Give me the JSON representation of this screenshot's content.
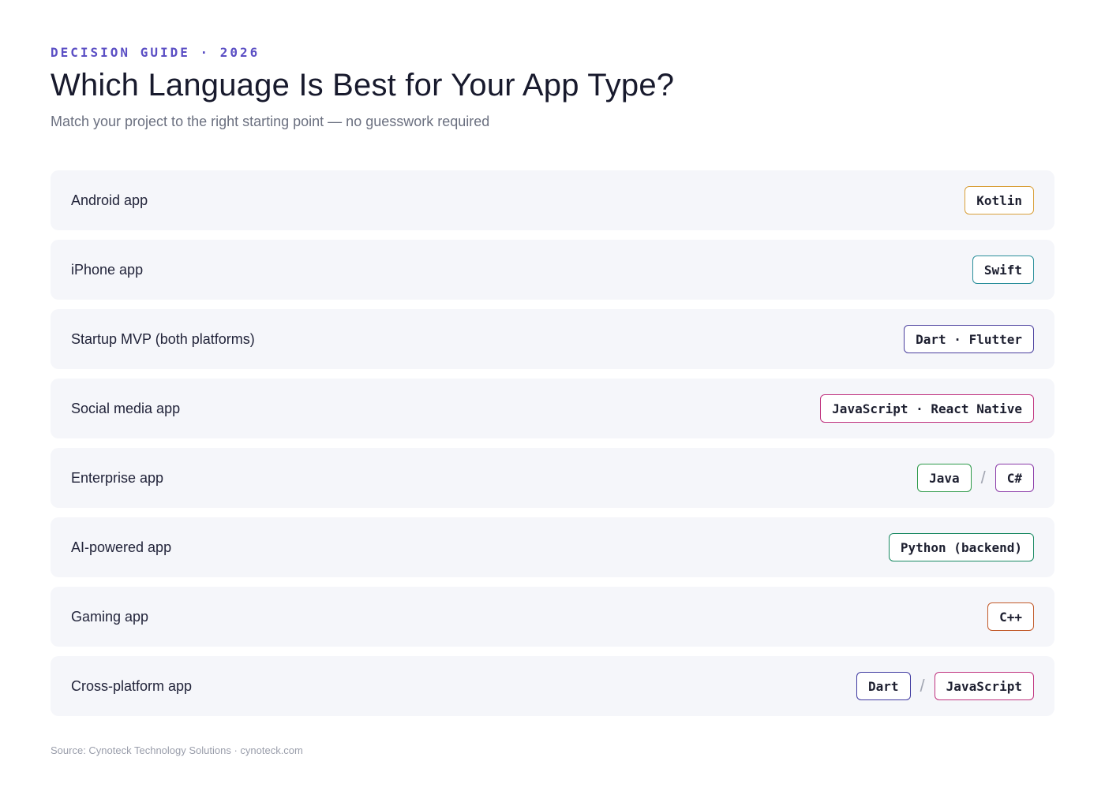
{
  "header": {
    "eyebrow": "DECISION GUIDE · 2026",
    "title": "Which Language Is Best for Your App Type?",
    "subtitle": "Match your project to the right starting point — no guesswork required"
  },
  "separator": "/",
  "rows": [
    {
      "label": "Android app",
      "tags": [
        {
          "text": "Kotlin",
          "color": "#d9a03a"
        }
      ]
    },
    {
      "label": "iPhone app",
      "tags": [
        {
          "text": "Swift",
          "color": "#2a8f9b"
        }
      ]
    },
    {
      "label": "Startup MVP (both platforms)",
      "tags": [
        {
          "text": "Dart · Flutter",
          "color": "#4a3f9e"
        }
      ]
    },
    {
      "label": "Social media app",
      "tags": [
        {
          "text": "JavaScript · React Native",
          "color": "#c0337f"
        }
      ]
    },
    {
      "label": "Enterprise app",
      "tags": [
        {
          "text": "Java",
          "color": "#2e9a4a"
        },
        {
          "text": "C#",
          "color": "#8a3aa8"
        }
      ]
    },
    {
      "label": "AI-powered app",
      "tags": [
        {
          "text": "Python (backend)",
          "color": "#1a8a63"
        }
      ]
    },
    {
      "label": "Gaming app",
      "tags": [
        {
          "text": "C++",
          "color": "#c25a2a"
        }
      ]
    },
    {
      "label": "Cross-platform app",
      "tags": [
        {
          "text": "Dart",
          "color": "#3f3aa0"
        },
        {
          "text": "JavaScript",
          "color": "#c0337f"
        }
      ]
    }
  ],
  "footer": {
    "source": "Source: Cynoteck Technology Solutions · cynoteck.com"
  }
}
